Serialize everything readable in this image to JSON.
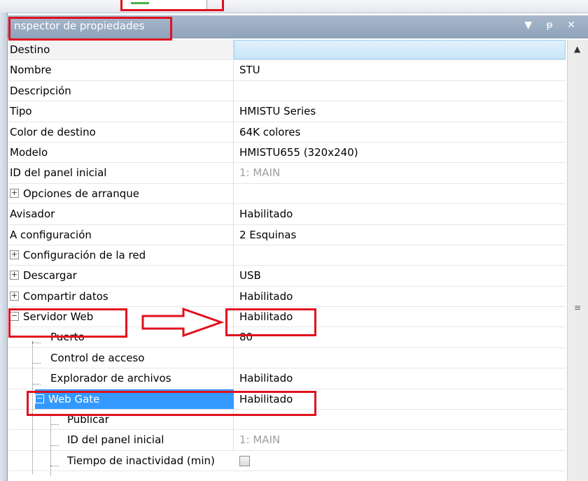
{
  "window": {
    "title": "nspector de propiedades",
    "controls": [
      "▼",
      "ᵽ",
      "✕"
    ]
  },
  "grid": {
    "header": {
      "name": "Destino",
      "value": ""
    },
    "rows": [
      {
        "name": "Nombre",
        "value": "STU"
      },
      {
        "name": "Descripción",
        "value": ""
      },
      {
        "name": "Tipo",
        "value": "HMISTU Series"
      },
      {
        "name": "Color de destino",
        "value": "64K colores"
      },
      {
        "name": "Modelo",
        "value": "HMISTU655 (320x240)"
      },
      {
        "name": "ID del panel inicial",
        "value": "1: MAIN"
      },
      {
        "name": "Opciones  de arranque",
        "value": ""
      },
      {
        "name": "Avisador",
        "value": "Habilitado"
      },
      {
        "name": "A configuración",
        "value": "2 Esquinas"
      },
      {
        "name": "Configuración de la red",
        "value": ""
      },
      {
        "name": "Descargar",
        "value": "USB"
      },
      {
        "name": "Compartir datos",
        "value": "Habilitado"
      },
      {
        "name": "Servidor Web",
        "value": "Habilitado"
      },
      {
        "name": "Puerto",
        "value": "80"
      },
      {
        "name": "Control de acceso",
        "value": ""
      },
      {
        "name": "Explorador de archivos",
        "value": "Habilitado"
      },
      {
        "name": "Web Gate",
        "value": "Habilitado"
      },
      {
        "name": "Publicar",
        "value": ""
      },
      {
        "name": "ID del panel inicial",
        "value": "1: MAIN"
      },
      {
        "name": "Tiempo de inactividad (min)",
        "value": ""
      }
    ]
  },
  "icons": {
    "expand": "+",
    "collapse": "−",
    "scroll_up": "▲",
    "scroll_grip": "≡"
  },
  "colors": {
    "highlight": "#e0111f",
    "selection": "#3399ff",
    "titlebar": "#9aabc2"
  }
}
